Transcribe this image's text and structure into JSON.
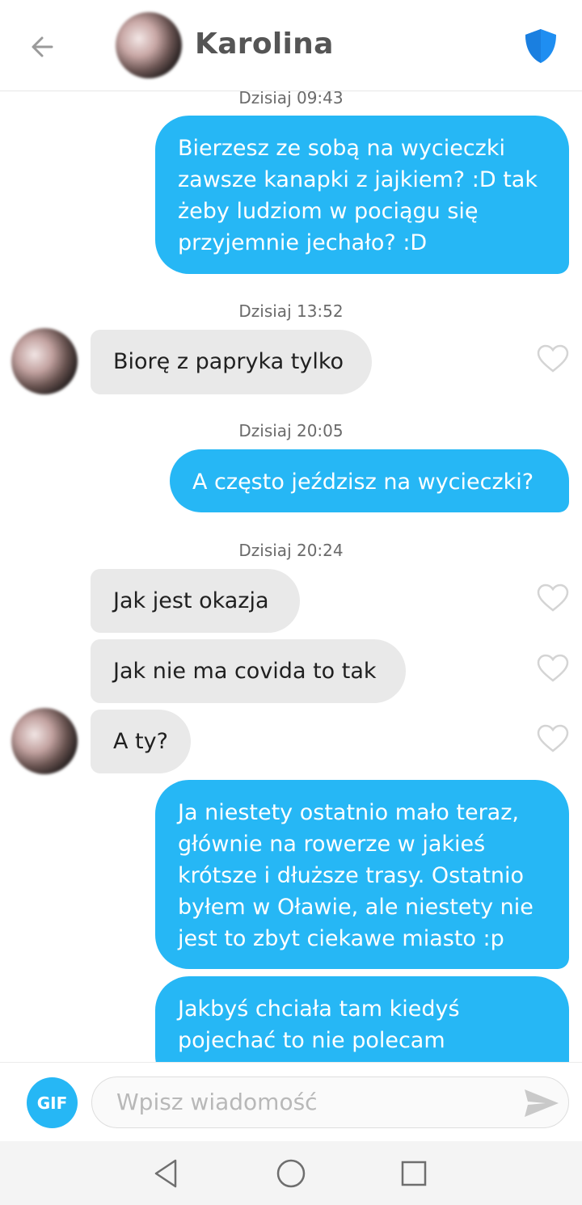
{
  "header": {
    "contact_name": "Karolina"
  },
  "messages": {
    "ts0": "Dzisiaj 09:43",
    "m1": "Bierzesz ze sobą na wycieczki zawsze kanapki z jajkiem? :D tak żeby ludziom w pociągu się przyjemnie jechało? :D",
    "ts1": "Dzisiaj 13:52",
    "m2": "Biorę z papryka tylko",
    "ts2": "Dzisiaj 20:05",
    "m3": "A często jeździsz na wycieczki?",
    "ts3": "Dzisiaj 20:24",
    "m4": "Jak jest okazja",
    "m5": "Jak nie ma covida to tak",
    "m6": "A ty?",
    "m7": "Ja niestety ostatnio mało teraz, głównie na rowerze w jakieś krótsze i dłuższe trasy. Ostatnio byłem w Oławie, ale niestety nie jest to zbyt ciekawe miasto :p",
    "m8": "Jakbyś chciała tam kiedyś pojechać to nie polecam"
  },
  "composer": {
    "gif_label": "GIF",
    "placeholder": "Wpisz wiadomość"
  },
  "colors": {
    "accent": "#26b7f5",
    "incoming_bubble": "#e9e9e9",
    "shield": "#1f8ef1"
  },
  "icons": [
    "back-arrow-icon",
    "shield-icon",
    "heart-icon",
    "send-icon",
    "nav-back-icon",
    "nav-home-icon",
    "nav-recents-icon"
  ]
}
